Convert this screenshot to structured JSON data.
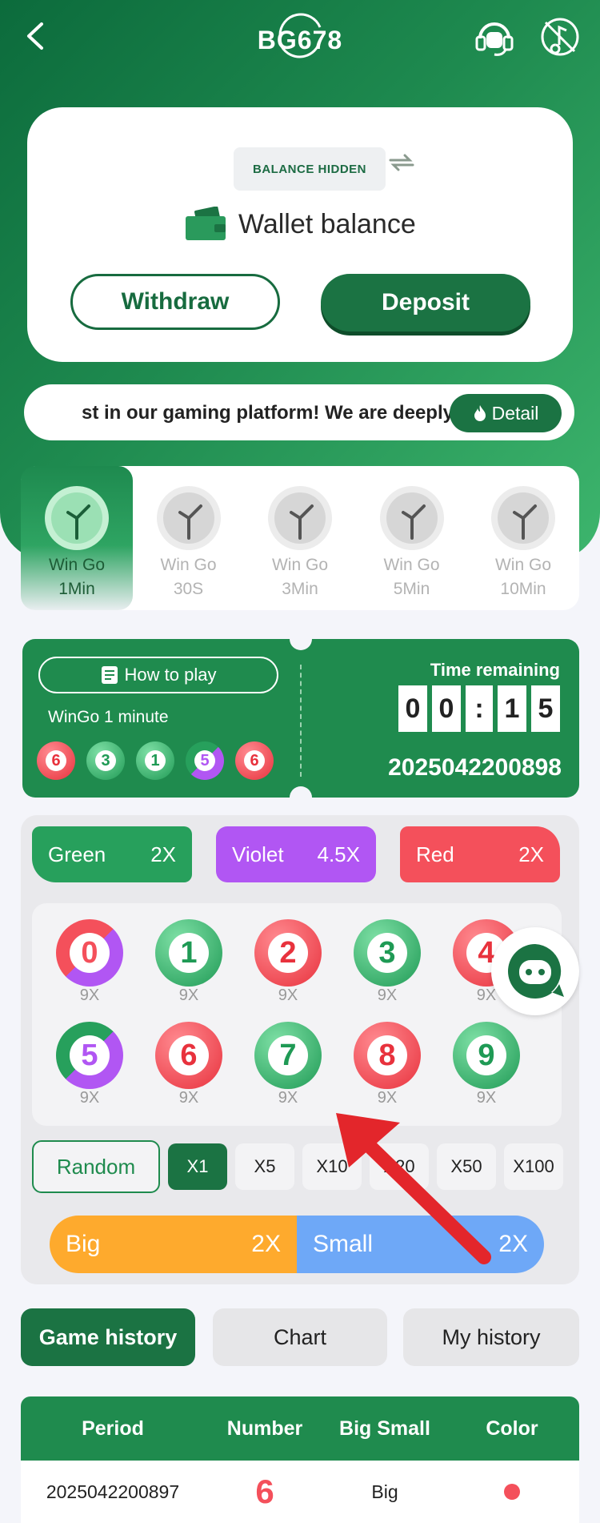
{
  "header": {
    "logo_text": "BG678"
  },
  "wallet": {
    "balance_hidden_label": "BALANCE HIDDEN",
    "label": "Wallet balance",
    "withdraw_label": "Withdraw",
    "deposit_label": "Deposit"
  },
  "notice": {
    "text": "st in our gaming platform! We are deeply",
    "detail_label": "Detail"
  },
  "game_tabs": [
    {
      "line1": "Win Go",
      "line2": "1Min",
      "active": true
    },
    {
      "line1": "Win Go",
      "line2": "30S",
      "active": false
    },
    {
      "line1": "Win Go",
      "line2": "3Min",
      "active": false
    },
    {
      "line1": "Win Go",
      "line2": "5Min",
      "active": false
    },
    {
      "line1": "Win Go",
      "line2": "10Min",
      "active": false
    }
  ],
  "round": {
    "how_to_play_label": "How to play",
    "game_name": "WinGo 1 minute",
    "recent_results": [
      "6",
      "3",
      "1",
      "5",
      "6"
    ],
    "time_remaining_label": "Time remaining",
    "timer_digits": [
      "0",
      "0",
      ":",
      "1",
      "5"
    ],
    "period_id": "2025042200898"
  },
  "colors_bet": {
    "green": {
      "label": "Green",
      "odds": "2X"
    },
    "violet": {
      "label": "Violet",
      "odds": "4.5X"
    },
    "red": {
      "label": "Red",
      "odds": "2X"
    }
  },
  "numbers": [
    {
      "n": "0",
      "mult": "9X"
    },
    {
      "n": "1",
      "mult": "9X"
    },
    {
      "n": "2",
      "mult": "9X"
    },
    {
      "n": "3",
      "mult": "9X"
    },
    {
      "n": "4",
      "mult": "9X"
    },
    {
      "n": "5",
      "mult": "9X"
    },
    {
      "n": "6",
      "mult": "9X"
    },
    {
      "n": "7",
      "mult": "9X"
    },
    {
      "n": "8",
      "mult": "9X"
    },
    {
      "n": "9",
      "mult": "9X"
    }
  ],
  "multipliers": {
    "random_label": "Random",
    "options": [
      "X1",
      "X5",
      "X10",
      "X20",
      "X50",
      "X100"
    ]
  },
  "big_small": {
    "big_label": "Big",
    "big_odds": "2X",
    "small_label": "Small",
    "small_odds": "2X"
  },
  "history_tabs": [
    "Game history",
    "Chart",
    "My history"
  ],
  "table": {
    "headers": [
      "Period",
      "Number",
      "Big Small",
      "Color"
    ],
    "rows": [
      {
        "period": "2025042200897",
        "number": "6",
        "big_small": "Big",
        "color": "red"
      }
    ]
  },
  "theme": {
    "primary": "#1b7343",
    "green": "#27a05c",
    "violet": "#b156f3",
    "red": "#f4505b",
    "big": "#feaa2d",
    "small": "#6ea8f7"
  }
}
